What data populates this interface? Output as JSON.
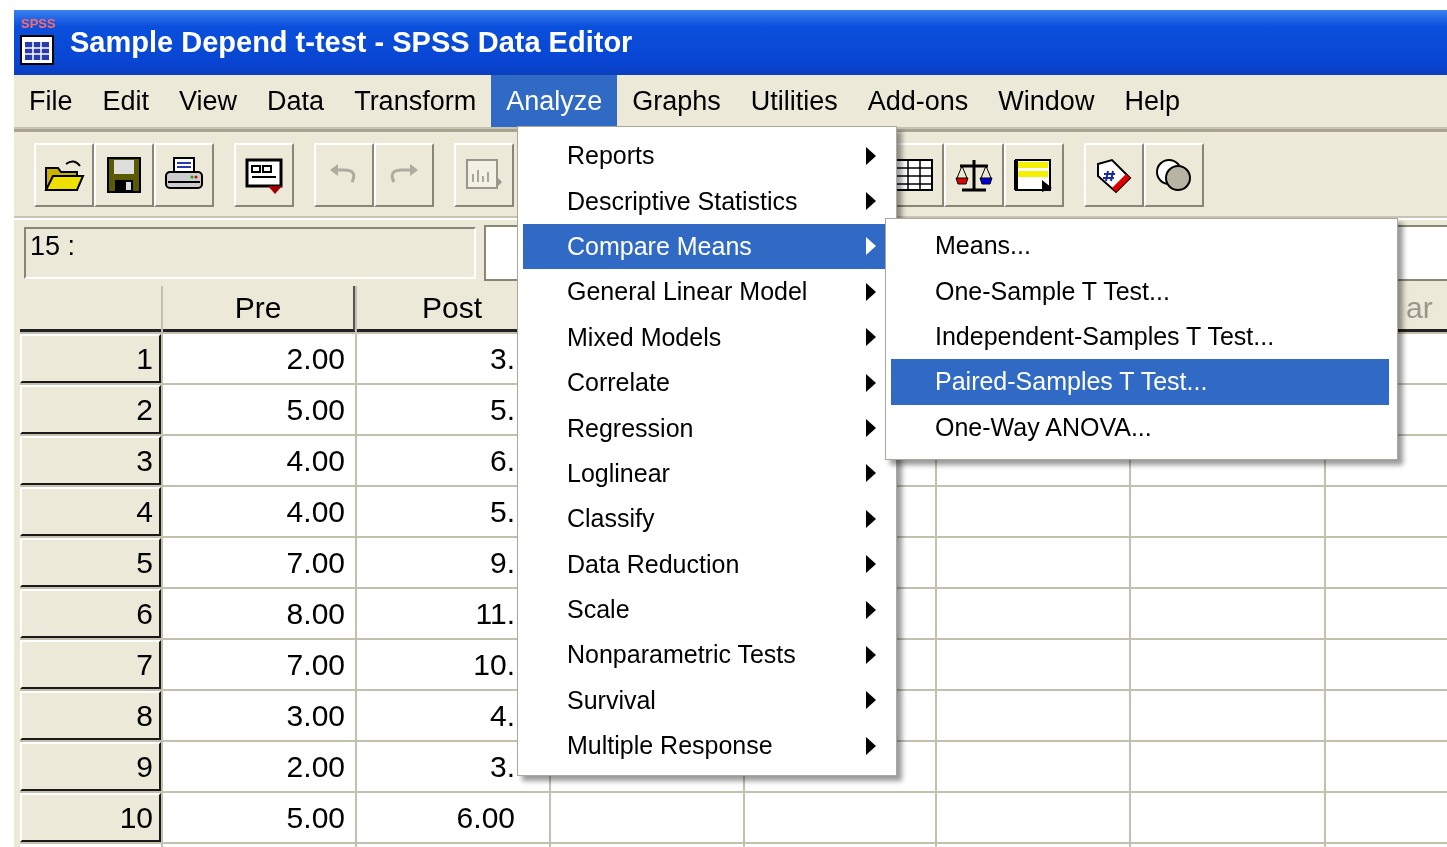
{
  "window": {
    "title": "Sample Depend t-test - SPSS Data Editor",
    "icon_label": "SPSS"
  },
  "menu_bar": [
    {
      "label": "File",
      "selected": false
    },
    {
      "label": "Edit",
      "selected": false
    },
    {
      "label": "View",
      "selected": false
    },
    {
      "label": "Data",
      "selected": false
    },
    {
      "label": "Transform",
      "selected": false
    },
    {
      "label": "Analyze",
      "selected": true
    },
    {
      "label": "Graphs",
      "selected": false
    },
    {
      "label": "Utilities",
      "selected": false
    },
    {
      "label": "Add-ons",
      "selected": false
    },
    {
      "label": "Window",
      "selected": false
    },
    {
      "label": "Help",
      "selected": false
    }
  ],
  "toolbar": [
    {
      "kind": "open",
      "disabled": false
    },
    {
      "kind": "save",
      "disabled": false
    },
    {
      "kind": "print",
      "disabled": false
    },
    {
      "kind": "recall",
      "disabled": false
    },
    {
      "kind": "undo",
      "disabled": true
    },
    {
      "kind": "redo",
      "disabled": true
    },
    {
      "kind": "chart",
      "disabled": true
    },
    {
      "kind": "table",
      "disabled": false
    },
    {
      "kind": "scale",
      "disabled": false
    },
    {
      "kind": "select",
      "disabled": false
    },
    {
      "kind": "tag",
      "disabled": false
    },
    {
      "kind": "circles",
      "disabled": false
    }
  ],
  "cell_ref": "15 :",
  "grid": {
    "columns": [
      "Pre",
      "Post"
    ],
    "partial_column_label": "ar",
    "rows": [
      {
        "number": "1",
        "values": [
          "2.00",
          "3."
        ]
      },
      {
        "number": "2",
        "values": [
          "5.00",
          "5."
        ]
      },
      {
        "number": "3",
        "values": [
          "4.00",
          "6."
        ]
      },
      {
        "number": "4",
        "values": [
          "4.00",
          "5."
        ]
      },
      {
        "number": "5",
        "values": [
          "7.00",
          "9."
        ]
      },
      {
        "number": "6",
        "values": [
          "8.00",
          "11."
        ]
      },
      {
        "number": "7",
        "values": [
          "7.00",
          "10."
        ]
      },
      {
        "number": "8",
        "values": [
          "3.00",
          "4."
        ]
      },
      {
        "number": "9",
        "values": [
          "2.00",
          "3."
        ]
      },
      {
        "number": "10",
        "values": [
          "5.00",
          "6.00"
        ]
      }
    ]
  },
  "analyze_menu": [
    {
      "label": "Reports",
      "selected": false,
      "submenu": true
    },
    {
      "label": "Descriptive Statistics",
      "selected": false,
      "submenu": true
    },
    {
      "label": "Compare Means",
      "selected": true,
      "submenu": true
    },
    {
      "label": "General Linear Model",
      "selected": false,
      "submenu": true
    },
    {
      "label": "Mixed Models",
      "selected": false,
      "submenu": true
    },
    {
      "label": "Correlate",
      "selected": false,
      "submenu": true
    },
    {
      "label": "Regression",
      "selected": false,
      "submenu": true
    },
    {
      "label": "Loglinear",
      "selected": false,
      "submenu": true
    },
    {
      "label": "Classify",
      "selected": false,
      "submenu": true
    },
    {
      "label": "Data Reduction",
      "selected": false,
      "submenu": true
    },
    {
      "label": "Scale",
      "selected": false,
      "submenu": true
    },
    {
      "label": "Nonparametric Tests",
      "selected": false,
      "submenu": true
    },
    {
      "label": "Survival",
      "selected": false,
      "submenu": true
    },
    {
      "label": "Multiple Response",
      "selected": false,
      "submenu": true
    }
  ],
  "compare_means_menu": [
    {
      "label": "Means...",
      "selected": false
    },
    {
      "label": "One-Sample T Test...",
      "selected": false
    },
    {
      "label": "Independent-Samples T Test...",
      "selected": false
    },
    {
      "label": "Paired-Samples T Test...",
      "selected": true
    },
    {
      "label": "One-Way ANOVA...",
      "selected": false
    }
  ]
}
